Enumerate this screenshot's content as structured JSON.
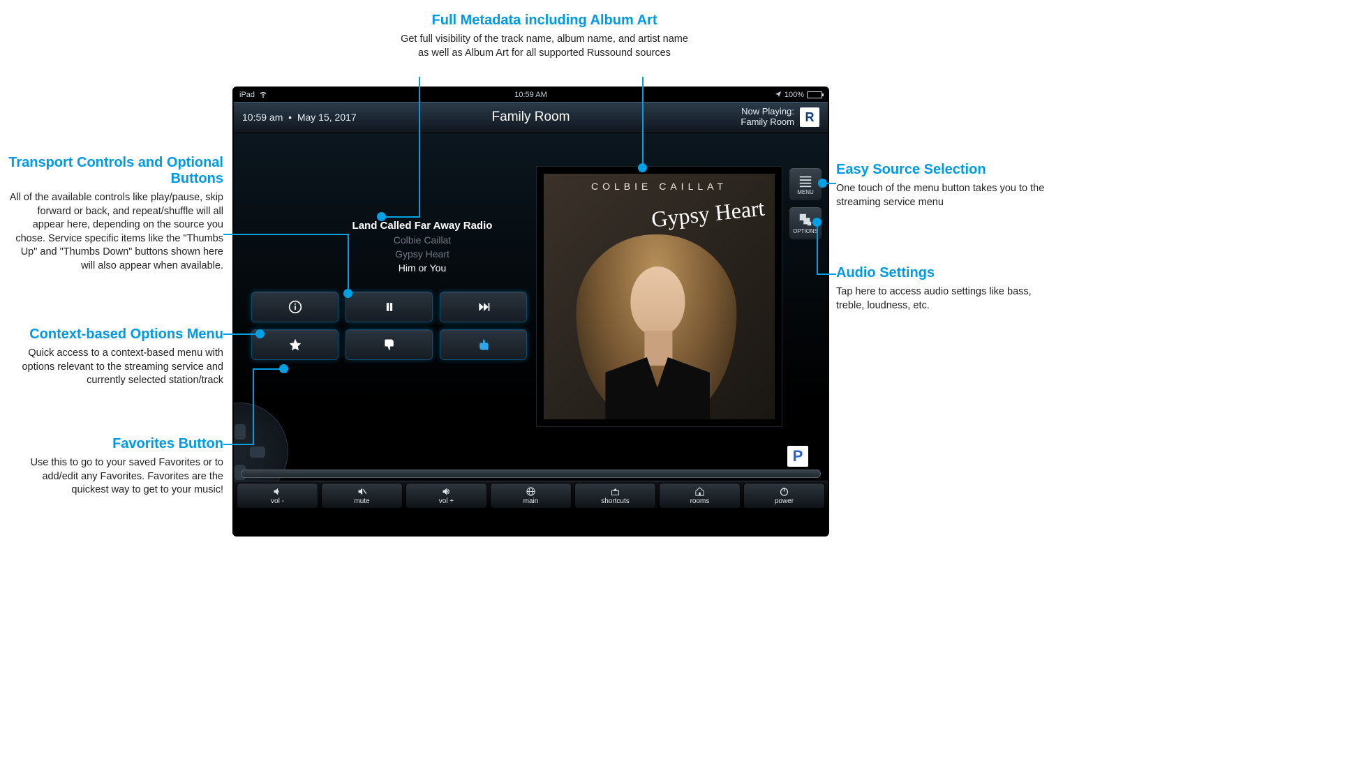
{
  "ios_status": {
    "device": "iPad",
    "time": "10:59 AM",
    "battery": "100%"
  },
  "header": {
    "time": "10:59 am",
    "sep": "•",
    "date": "May 15, 2017",
    "title": "Family Room",
    "now_playing_label": "Now Playing:",
    "now_playing_room": "Family Room",
    "logo_letter": "R"
  },
  "metadata": {
    "station": "Land Called Far Away Radio",
    "artist": "Colbie Caillat",
    "album": "Gypsy Heart",
    "track": "Him or You"
  },
  "album_art": {
    "artist_display": "COLBIE CAILLAT",
    "album_cursive": "Gypsy Heart"
  },
  "side_buttons": {
    "menu": "MENU",
    "options": "OPTIONS"
  },
  "service_badge": "P",
  "bottom_bar": {
    "vol_minus": "vol -",
    "mute": "mute",
    "vol_plus": "vol +",
    "main": "main",
    "shortcuts": "shortcuts",
    "rooms": "rooms",
    "power": "power"
  },
  "transport_icons": {
    "info": "info-icon",
    "pause": "pause-icon",
    "next": "next-track-icon",
    "star": "star-icon",
    "thumb_down": "thumb-down-icon",
    "thumb_up": "thumb-up-icon"
  },
  "annotations": {
    "metadata": {
      "title": "Full Metadata including Album Art",
      "body": "Get full visibility of the track name, album name, and artist name as well as Album Art for all supported Russound sources"
    },
    "transport": {
      "title": "Transport Controls and Optional Buttons",
      "body": "All of the available controls like play/pause, skip forward or back, and repeat/shuffle will all appear here, depending on the source you chose.  Service specific items like the \"Thumbs Up\" and \"Thumbs Down\" buttons shown here will also appear when available."
    },
    "context": {
      "title": "Context-based Options Menu",
      "body": "Quick access to a context-based menu with options relevant to the streaming service and currently selected station/track"
    },
    "favorites": {
      "title": "Favorites Button",
      "body": "Use this to go to your saved Favorites or to add/edit any Favorites.  Favorites are the quickest way to get to your music!"
    },
    "source": {
      "title": "Easy Source Selection",
      "body": "One touch of the menu button takes you to the streaming service menu"
    },
    "audio": {
      "title": "Audio Settings",
      "body": "Tap here to access audio settings like bass, treble, loudness, etc."
    }
  }
}
